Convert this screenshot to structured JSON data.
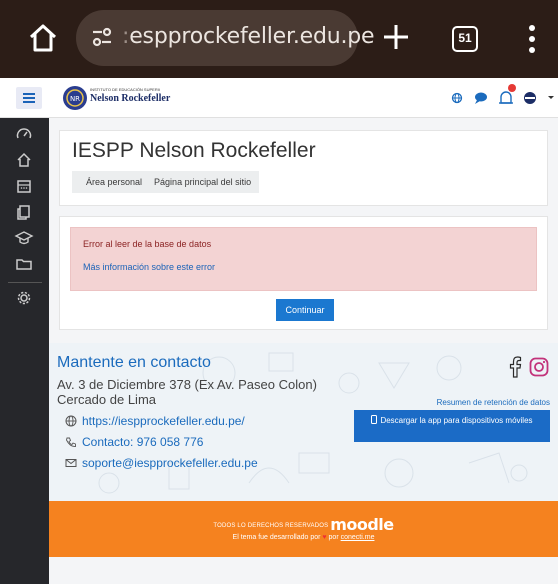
{
  "browser": {
    "url": "espprockefeller.edu.pe",
    "url_prefix": ":",
    "tab_count": "51"
  },
  "site": {
    "logo_line1": "INSTITUTO DE EDUCACIÓN SUPERIOR PEDAGÓGICO PRIVADO",
    "logo_name": "Nelson Rockefeller"
  },
  "header": {
    "title": "IESPP Nelson Rockefeller",
    "breadcrumb": [
      "Área personal",
      "Página principal del sitio"
    ]
  },
  "alert": {
    "message": "Error al leer de la base de datos",
    "more_info": "Más información sobre este error"
  },
  "continue_label": "Continuar",
  "footer": {
    "contact_title": "Mantente en contacto",
    "address_line1": "Av. 3 de Diciembre 378 (Ex Av. Paseo Colon)",
    "address_line2": "Cercado de Lima",
    "website": "https://iespprockefeller.edu.pe/",
    "phone": "Contacto: 976 058 776",
    "email": "soporte@iespprockefeller.edu.pe",
    "retention_link": "Resumen de retención de datos",
    "app_button": "Descargar la app para dispositivos móviles",
    "rights": "TODOS LO DERECHOS RESERVADOS",
    "moodle": "moodle",
    "credit_prefix": "El tema fue desarrollado por",
    "credit_by": "por",
    "credit_link": "conecti.me"
  },
  "colors": {
    "accent": "#1b6bbd",
    "brand_orange": "#f5821f",
    "alert_bg": "#f3d3d3",
    "drawer_bg": "#26272b",
    "notification": "#e53935"
  }
}
